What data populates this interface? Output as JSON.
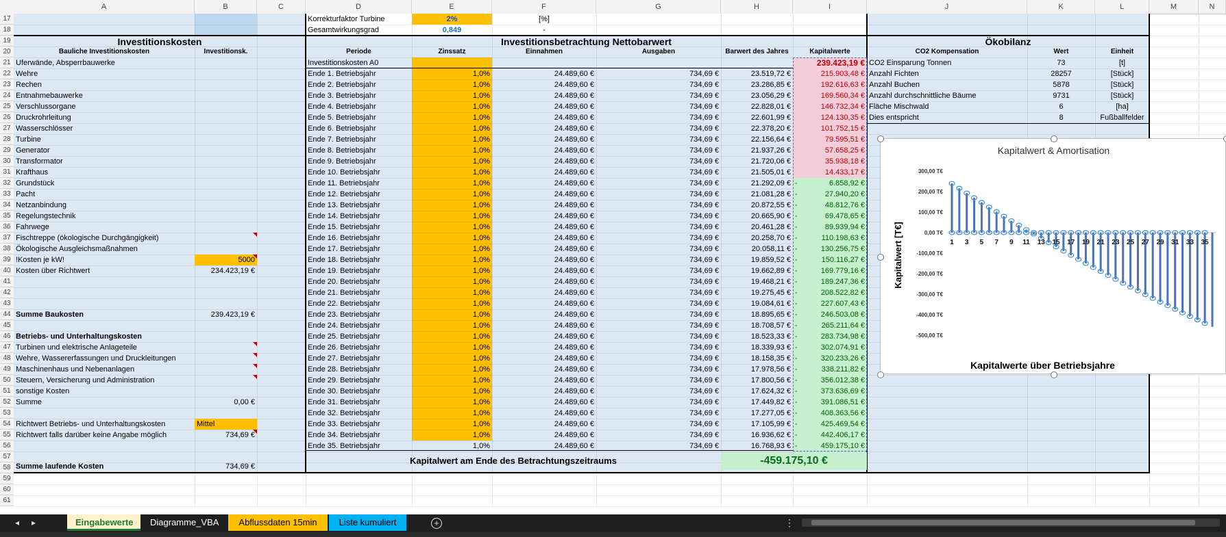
{
  "columns": [
    "A",
    "B",
    "C",
    "D",
    "E",
    "F",
    "G",
    "H",
    "I",
    "J",
    "K",
    "L",
    "M",
    "N"
  ],
  "rows": [
    "17",
    "18",
    "19",
    "20",
    "21",
    "22",
    "23",
    "24",
    "25",
    "26",
    "27",
    "28",
    "29",
    "30",
    "31",
    "32",
    "33",
    "34",
    "35",
    "36",
    "37",
    "38",
    "39",
    "40",
    "41",
    "42",
    "43",
    "44",
    "45",
    "46",
    "47",
    "48",
    "49",
    "50",
    "51",
    "52",
    "53",
    "54",
    "55",
    "56",
    "57",
    "58",
    "59",
    "60",
    "61"
  ],
  "top": {
    "korrektur_label": "Korrekturfaktor Turbine",
    "korrektur_value": "2%",
    "korrektur_unit": "[%]",
    "gesamt_label": "Gesamtwirkungsgrad",
    "gesamt_value": "0,849",
    "gesamt_unit": "-"
  },
  "invest": {
    "title": "Investitionskosten",
    "head_a": "Bauliche Investitionskosten",
    "head_b": "Investitionsk.",
    "items": [
      "Uferwände, Absperrbauwerke",
      "Wehre",
      "Rechen",
      "Entnahmebauwerke",
      "Verschlussorgane",
      "Druckrohrleitung",
      "Wasserschlösser",
      "Turbine",
      "Generator",
      "Transformator",
      "Krafthaus",
      "Grundstück",
      "Pacht",
      "Netzanbindung",
      "Regelungstechnik",
      "Fahrwege",
      "Fischtreppe (ökologische Durchgängigkeit)",
      "Ökologische Ausgleichsmaßnahmen"
    ],
    "kw_label": "!Kosten je kW!",
    "kw_value": "5000",
    "richt_label": "Kosten über Richtwert",
    "richt_value": "234.423,19 €",
    "summe_bau_label": "Summe Baukosten",
    "summe_bau_value": "239.423,19 €",
    "betrieb_title": "Betriebs- und Unterhaltungskosten",
    "betrieb_items": [
      "Turbinen und elektrische Anlageteile",
      "Wehre, Wassererfassungen und Druckleitungen",
      "Maschinenhaus und Nebenanlagen",
      "Steuern, Versicherung und Administration",
      "sonstige Kosten"
    ],
    "summe_label": "Summe",
    "summe_value": "0,00 €",
    "richtwert_bu_label": "Richtwert Betriebs- und Unterhaltungskosten",
    "richtwert_bu_value": "Mittel",
    "richtwert_falls_label": "Richtwert falls darüber keine Angabe möglich",
    "richtwert_falls_value": "734,69 €",
    "laufend_label": "Summe laufende Kosten",
    "laufend_value": "734,69 €"
  },
  "npv": {
    "title": "Investitionsbetrachtung Nettobarwert",
    "headers": [
      "Periode",
      "Zinssatz",
      "Einnahmen",
      "Ausgaben",
      "Barwert des Jahres",
      "Kapitalwerte"
    ],
    "a0_label": "Investitionskosten A0",
    "a0_value": "239.423,19 €",
    "zins": "1,0%",
    "einnahmen": "24.489,60 €",
    "ausgaben": "734,69 €",
    "rows": [
      [
        "Ende 1. Betriebsjahr",
        "23.519,72 €",
        "215.903,48 €"
      ],
      [
        "Ende 2. Betriebsjahr",
        "23.286,85 €",
        "192.616,63 €"
      ],
      [
        "Ende 3. Betriebsjahr",
        "23.056,29 €",
        "169.560,34 €"
      ],
      [
        "Ende 4. Betriebsjahr",
        "22.828,01 €",
        "146.732,34 €"
      ],
      [
        "Ende 5. Betriebsjahr",
        "22.601,99 €",
        "124.130,35 €"
      ],
      [
        "Ende 6. Betriebsjahr",
        "22.378,20 €",
        "101.752,15 €"
      ],
      [
        "Ende 7. Betriebsjahr",
        "22.156,64 €",
        "79.595,51 €"
      ],
      [
        "Ende 8. Betriebsjahr",
        "21.937,26 €",
        "57.658,25 €"
      ],
      [
        "Ende 9. Betriebsjahr",
        "21.720,06 €",
        "35.938,18 €"
      ],
      [
        "Ende 10. Betriebsjahr",
        "21.505,01 €",
        "14.433,17 €"
      ],
      [
        "Ende 11. Betriebsjahr",
        "21.292,09 €",
        "6.858,92 €"
      ],
      [
        "Ende 12. Betriebsjahr",
        "21.081,28 €",
        "27.940,20 €"
      ],
      [
        "Ende 13. Betriebsjahr",
        "20.872,55 €",
        "48.812,76 €"
      ],
      [
        "Ende 14. Betriebsjahr",
        "20.665,90 €",
        "69.478,65 €"
      ],
      [
        "Ende 15. Betriebsjahr",
        "20.461,28 €",
        "89.939,94 €"
      ],
      [
        "Ende 16. Betriebsjahr",
        "20.258,70 €",
        "110.198,63 €"
      ],
      [
        "Ende 17. Betriebsjahr",
        "20.058,11 €",
        "130.256,75 €"
      ],
      [
        "Ende 18. Betriebsjahr",
        "19.859,52 €",
        "150.116,27 €"
      ],
      [
        "Ende 19. Betriebsjahr",
        "19.662,89 €",
        "169.779,16 €"
      ],
      [
        "Ende 20. Betriebsjahr",
        "19.468,21 €",
        "189.247,36 €"
      ],
      [
        "Ende 21. Betriebsjahr",
        "19.275,45 €",
        "208.522,82 €"
      ],
      [
        "Ende 22. Betriebsjahr",
        "19.084,61 €",
        "227.607,43 €"
      ],
      [
        "Ende 23. Betriebsjahr",
        "18.895,65 €",
        "246.503,08 €"
      ],
      [
        "Ende 24. Betriebsjahr",
        "18.708,57 €",
        "265.211,64 €"
      ],
      [
        "Ende 25. Betriebsjahr",
        "18.523,33 €",
        "283.734,98 €"
      ],
      [
        "Ende 26. Betriebsjahr",
        "18.339,93 €",
        "302.074,91 €"
      ],
      [
        "Ende 27. Betriebsjahr",
        "18.158,35 €",
        "320.233,26 €"
      ],
      [
        "Ende 28. Betriebsjahr",
        "17.978,56 €",
        "338.211,82 €"
      ],
      [
        "Ende 29. Betriebsjahr",
        "17.800,56 €",
        "356.012,38 €"
      ],
      [
        "Ende 30. Betriebsjahr",
        "17.624,32 €",
        "373.636,69 €"
      ],
      [
        "Ende 31. Betriebsjahr",
        "17.449,82 €",
        "391.086,51 €"
      ],
      [
        "Ende 32. Betriebsjahr",
        "17.277,05 €",
        "408.363,56 €"
      ],
      [
        "Ende 33. Betriebsjahr",
        "17.105,99 €",
        "425.469,54 €"
      ],
      [
        "Ende 34. Betriebsjahr",
        "16.936,62 €",
        "442.406,17 €"
      ],
      [
        "Ende 35. Betriebsjahr",
        "16.768,93 €",
        "459.175,10 €"
      ]
    ],
    "neg_prefix": "-",
    "end_label": "Kapitalwert am Ende des Betrachtungszeitraums",
    "end_value": "-459.175,10 €"
  },
  "oeko": {
    "title": "Ökobilanz",
    "headers": [
      "CO2 Kompensation",
      "Wert",
      "Einheit"
    ],
    "rows": [
      [
        "CO2 Einsparung Tonnen",
        "73",
        "[t]"
      ],
      [
        "Anzahl Fichten",
        "28257",
        "[Stück]"
      ],
      [
        "Anzahl Buchen",
        "5878",
        "[Stück]"
      ],
      [
        "Anzahl durchschnittliche Bäume",
        "9731",
        "[Stück]"
      ],
      [
        "Fläche Mischwald",
        "6",
        "[ha]"
      ],
      [
        "Dies entspricht",
        "8",
        "Fußballfelder"
      ]
    ]
  },
  "chart_data": {
    "type": "bar",
    "title": "Kapitalwert & Amortisation",
    "xlabel": "Kapitalwerte über Betriebsjahre",
    "ylabel": "Kapitalwert [T€]",
    "ylim": [
      -500,
      300
    ],
    "yticks": [
      "300,00 T€",
      "200,00 T€",
      "100,00 T€",
      "0,00 T€",
      "-100,00 T€",
      "-200,00 T€",
      "-300,00 T€",
      "-400,00 T€",
      "-500,00 T€"
    ],
    "xtick_labels": [
      "1",
      "3",
      "5",
      "7",
      "9",
      "11",
      "13",
      "15",
      "17",
      "19",
      "21",
      "23",
      "25",
      "27",
      "29",
      "31",
      "33",
      "35"
    ],
    "x": [
      1,
      2,
      3,
      4,
      5,
      6,
      7,
      8,
      9,
      10,
      11,
      12,
      13,
      14,
      15,
      16,
      17,
      18,
      19,
      20,
      21,
      22,
      23,
      24,
      25,
      26,
      27,
      28,
      29,
      30,
      31,
      32,
      33,
      34,
      35,
      36
    ],
    "values": [
      239.42,
      215.9,
      192.62,
      169.56,
      146.73,
      124.13,
      101.75,
      79.6,
      57.66,
      35.94,
      14.43,
      -6.86,
      -27.94,
      -48.81,
      -69.48,
      -89.94,
      -110.2,
      -130.26,
      -150.12,
      -169.78,
      -189.25,
      -208.52,
      -227.61,
      -246.5,
      -265.21,
      -283.73,
      -302.07,
      -320.23,
      -338.21,
      -356.01,
      -373.64,
      -391.09,
      -408.36,
      -425.47,
      -442.41,
      -459.18
    ],
    "color": "#4a72b8",
    "grid": false
  },
  "tabs": {
    "items": [
      {
        "label": "Eingabewerte",
        "bg": "#fff2cc",
        "fg": "#1e7a2e",
        "active": true
      },
      {
        "label": "Diagramme_VBA",
        "bg": "#1f1f1f",
        "fg": "#ffffff",
        "active": false
      },
      {
        "label": "Abflussdaten 15min",
        "bg": "#ffc000",
        "fg": "#000000",
        "active": false
      },
      {
        "label": "Liste kumuliert",
        "bg": "#00b0f0",
        "fg": "#000000",
        "active": false
      }
    ]
  },
  "colors": {
    "panel": "#dde8f5",
    "yellow": "#ffc000",
    "pink": "#f2ccd8",
    "green": "#c6efce",
    "red_text": "#c00000",
    "green_text": "#006100"
  }
}
